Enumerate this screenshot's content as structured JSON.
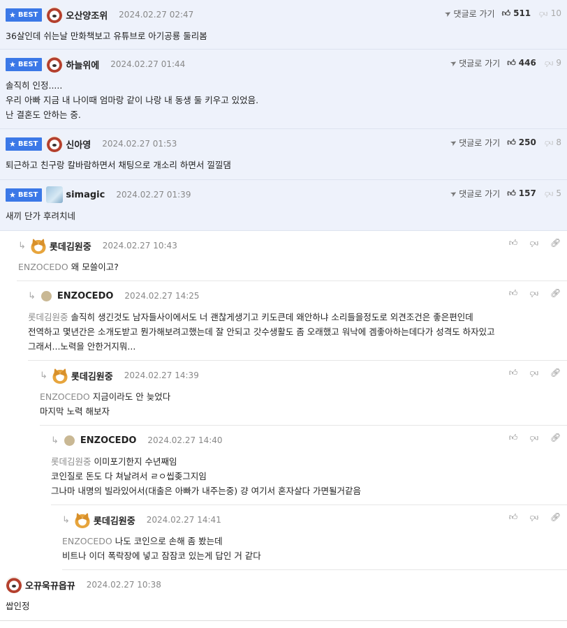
{
  "best_label": "BEST",
  "goto_label": "댓글로 가기",
  "best_comments": [
    {
      "nick": "오산양조위",
      "date": "2024.02.27 02:47",
      "up": "511",
      "down": "10",
      "lines": [
        "36살인데 쉬는날 만화책보고 유튜브로 아기공룡 둘리봄"
      ]
    },
    {
      "nick": "하늘위에",
      "date": "2024.02.27 01:44",
      "up": "446",
      "down": "9",
      "lines": [
        "솔직히 인정.....",
        "우리 아빠 지금 내 나이때 엄마랑 같이 나랑 내 동생 둘 키우고 있었음.",
        "난 결혼도 안하는 중."
      ]
    },
    {
      "nick": "신아영",
      "date": "2024.02.27 01:53",
      "up": "250",
      "down": "8",
      "lines": [
        "퇴근하고 친구랑 칼바람하면서 채팅으로 개소리 하면서 낄낄댐"
      ]
    },
    {
      "nick": "simagic",
      "date": "2024.02.27 01:39",
      "up": "157",
      "down": "5",
      "lines": [
        "새끼 단가 후려치네"
      ]
    }
  ],
  "replies": [
    {
      "nick": "롯데김원중",
      "date": "2024.02.27 10:43",
      "mention": "ENZOCEDO",
      "lines": [
        "왜 모쓸이고?"
      ]
    },
    {
      "nick": "ENZOCEDO",
      "date": "2024.02.27 14:25",
      "mention": "롯데김원중",
      "lines": [
        "솔직히 생긴것도 남자들사이에서도 너 괜찮게생기고 키도큰데 왜안하냐 소리들을정도로 외견조건은 좋은편인데",
        "전역하고 몇년간은 소개도받고 뭔가해보려고했는데 잘 안되고 갓수생활도 좀 오래했고 워낙에 겜좋아하는데다가 성격도 하자있고",
        "그래서...노력을 안한거지뭐..."
      ]
    },
    {
      "nick": "롯데김원중",
      "date": "2024.02.27 14:39",
      "mention": "ENZOCEDO",
      "lines": [
        "지금이라도 안 늦었다",
        "마지막 노력 해보자"
      ]
    },
    {
      "nick": "ENZOCEDO",
      "date": "2024.02.27 14:40",
      "mention": "롯데김원중",
      "lines": [
        "이미포기한지 수년째임",
        "코인질로 돈도 다 쳐날려서 ㄹㅇ씹좆그지임",
        "그나마 내명의 빌라있어서(대출은 아빠가 내주는중) 걍 여기서 혼자살다 가면될거같음"
      ]
    },
    {
      "nick": "롯데김원중",
      "date": "2024.02.27 14:41",
      "mention": "ENZOCEDO",
      "lines": [
        "나도 코인으로 손해 좀 봤는데",
        "비트나 이더 폭락장에 넣고 잠잠코 있는게 답인 거 같다"
      ]
    }
  ],
  "normal_comment": {
    "nick": "오뀨욱뀨읍뀨",
    "date": "2024.02.27 10:38",
    "lines": [
      "쌉인정"
    ]
  }
}
